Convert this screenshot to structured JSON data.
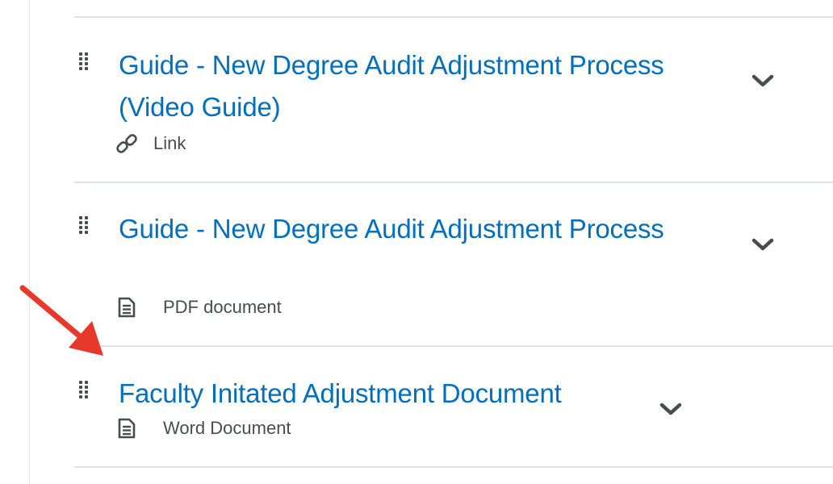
{
  "content_list": {
    "items": [
      {
        "title": "Guide - New Degree Audit Adjustment Process (Video Guide)",
        "type_label": "Link",
        "type_icon": "link-icon"
      },
      {
        "title": "Guide - New Degree Audit Adjustment Process",
        "type_label": "PDF document",
        "type_icon": "document-icon"
      },
      {
        "title": "Faculty Initated Adjustment Document",
        "type_label": "Word Document",
        "type_icon": "document-icon"
      }
    ]
  },
  "annotation": {
    "arrow_icon": "red-arrow-icon",
    "arrow_color": "#e8382b"
  },
  "colors": {
    "link_blue": "#006fbf",
    "text_gray": "#494c4e",
    "divider": "#dfe3e8"
  }
}
